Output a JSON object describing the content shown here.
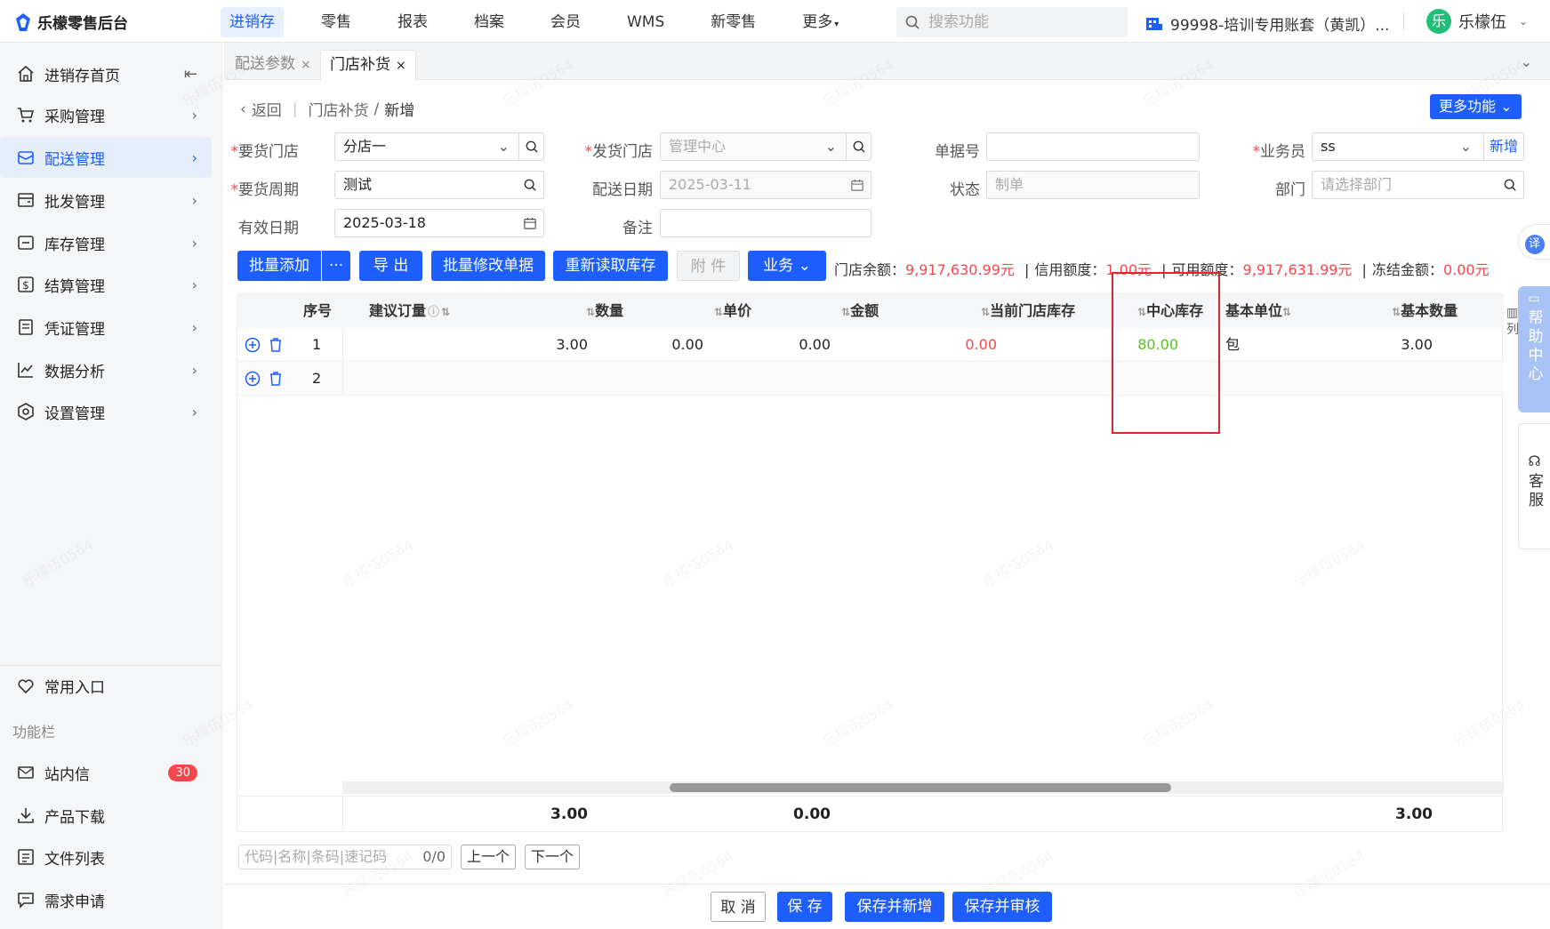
{
  "app": {
    "title": "乐檬零售后台"
  },
  "topnav": {
    "items": [
      "进销存",
      "零售",
      "报表",
      "档案",
      "会员",
      "WMS",
      "新零售",
      "更多"
    ],
    "active": 0,
    "search_placeholder": "搜索功能",
    "account": "99998-培训专用账套（黄凯）...",
    "user_initial": "乐",
    "user_name": "乐檬伍"
  },
  "sidebar": {
    "items": [
      {
        "label": "进销存首页",
        "icon": "home-icon"
      },
      {
        "label": "采购管理",
        "icon": "cart-icon"
      },
      {
        "label": "配送管理",
        "icon": "delivery-icon"
      },
      {
        "label": "批发管理",
        "icon": "wallet-icon"
      },
      {
        "label": "库存管理",
        "icon": "box-icon"
      },
      {
        "label": "结算管理",
        "icon": "dollar-icon"
      },
      {
        "label": "凭证管理",
        "icon": "voucher-icon"
      },
      {
        "label": "数据分析",
        "icon": "chart-icon"
      },
      {
        "label": "设置管理",
        "icon": "settings-icon"
      }
    ],
    "common_entry": "常用入口",
    "section_label": "功能栏",
    "func": [
      {
        "label": "站内信",
        "badge": "30"
      },
      {
        "label": "产品下载"
      },
      {
        "label": "文件列表"
      },
      {
        "label": "需求申请"
      }
    ]
  },
  "tabs": [
    {
      "label": "配送参数",
      "close": "×"
    },
    {
      "label": "门店补货",
      "close": "×"
    }
  ],
  "breadcrumb": {
    "back": "返回",
    "parent": "门店补货",
    "sep": "/",
    "current": "新增"
  },
  "more_func": "更多功能",
  "form": {
    "req_store_label": "要货门店",
    "req_store": "分店一",
    "send_store_label": "发货门店",
    "send_store": "管理中心",
    "doc_no_label": "单据号",
    "doc_no": "",
    "salesman_label": "业务员",
    "salesman": "ss",
    "salesman_add": "新增",
    "req_cycle_label": "要货周期",
    "req_cycle": "测试",
    "delivery_date_label": "配送日期",
    "delivery_date": "2025-03-11",
    "status_label": "状态",
    "status": "制单",
    "dept_label": "部门",
    "dept_placeholder": "请选择部门",
    "valid_date_label": "有效日期",
    "valid_date": "2025-03-18",
    "remark_label": "备注",
    "remark": ""
  },
  "toolbar": {
    "batch_add": "批量添加",
    "more": "···",
    "export": "导 出",
    "batch_edit": "批量修改单据",
    "reload_stock": "重新读取库存",
    "attach": "附 件",
    "business": "业务"
  },
  "info": {
    "store_balance_label": "门店余额：",
    "store_balance": "9,917,630.99元",
    "credit_label": "信用额度：",
    "credit": "1.00元",
    "available_label": "可用额度：",
    "available": "9,917,631.99元",
    "frozen_label": "冻结金额：",
    "frozen": "0.00元"
  },
  "table": {
    "headers": [
      "序号",
      "建议订量",
      "数量",
      "单价",
      "金额",
      "当前门店库存",
      "中心库存",
      "基本单位",
      "基本数量"
    ],
    "rows": [
      {
        "no": "1",
        "suggest": "",
        "qty": "3.00",
        "price": "0.00",
        "amount": "0.00",
        "store_stock": "0.00",
        "center_stock": "80.00",
        "unit": "包",
        "base_qty": "3.00"
      },
      {
        "no": "2",
        "suggest": "",
        "qty": "",
        "price": "",
        "amount": "",
        "store_stock": "",
        "center_stock": "",
        "unit": "",
        "base_qty": ""
      }
    ],
    "footer": {
      "qty": "3.00",
      "amount": "0.00",
      "base_qty": "3.00"
    },
    "col_setting": "列"
  },
  "pager": {
    "placeholder": "代码|名称|条码|速记码",
    "count": "0/0",
    "prev": "上一个",
    "next": "下一个"
  },
  "actions": {
    "cancel": "取 消",
    "save": "保 存",
    "save_new": "保存并新增",
    "save_audit": "保存并审核"
  },
  "right_tabs": {
    "translate": "译",
    "help": "帮助中心",
    "service": "客服"
  },
  "watermark": "乐檬伍0564",
  "colors": {
    "primary": "#1e5eff",
    "danger": "#f5484d",
    "green": "#52c41a"
  }
}
